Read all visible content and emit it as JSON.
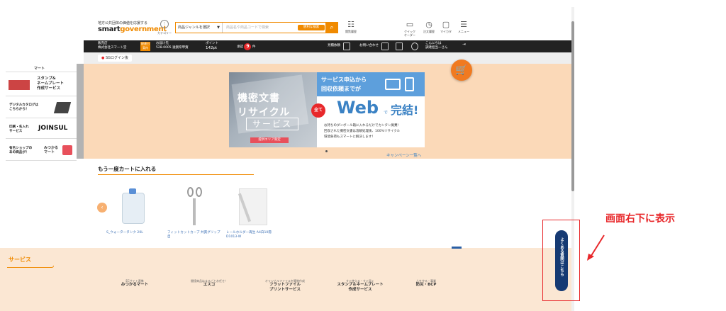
{
  "header": {
    "logo_sub": "地方公共団体の価値を応援する",
    "logo_main_a": "smart",
    "logo_main_b": "government",
    "category_label": "カテゴリー",
    "search_select": "商品ジャンルを選択",
    "search_placeholder": "商品名や商品コードで検索",
    "search_convenient": "便利な検索",
    "icons": [
      {
        "name": "purchase-history-icon",
        "label": "閲覧履歴"
      },
      {
        "name": "quick-order-icon",
        "label": "クイック\nオーダー"
      },
      {
        "name": "order-history-icon",
        "label": "注文履歴"
      },
      {
        "name": "my-folder-icon",
        "label": "マイカタ"
      },
      {
        "name": "menu-icon",
        "label": "メニュー"
      }
    ]
  },
  "blackbar": {
    "seller_label": "販売店",
    "seller_name": "株式会社スマート堂",
    "delivery_badge": "配達日\n案内",
    "delivery_label": "お届け先",
    "delivery_addr": "528-0005 滋賀県甲賀",
    "points_label": "ポイント",
    "points_value": "142pt",
    "approval_label": "承認",
    "approval_count": "9",
    "approval_unit": "件",
    "history_label": "見積依頼",
    "contact_label": "お問い合わせ",
    "greeting1": "こんにちは",
    "greeting2": "調達担当一さん"
  },
  "subbar": {
    "login_chip": "SGログイン後"
  },
  "sidebar": [
    {
      "title": "",
      "sub": "マート"
    },
    {
      "title": "",
      "sub": "スタンプ&\nネームプレート\n作成サービス"
    },
    {
      "title": "デジタルカタログは\nこちらから！",
      "sub": ""
    },
    {
      "title": "印刷・名入れ\nサービス",
      "sub": "JOINSUL"
    },
    {
      "title": "有名ショップの\nあの商品が！",
      "sub": "みつかる\nマート"
    }
  ],
  "banner": {
    "left_line1": "機密文書",
    "left_line2": "リサイクル",
    "left_line3": "サービス",
    "left_tag": "提供エリア限定",
    "right_head1": "サービス申込から",
    "right_head2": "回収依頼までが",
    "all_badge": "全て",
    "web": "Web",
    "de": "で",
    "kanketsu": "完結!",
    "desc1": "お持ちのダンボール箱に入れるだけでカンタン廃棄!",
    "desc2": "回収された機密文書は溶解処理後、100%リサイクル",
    "desc3": "環境負荷もスマートに解決します！"
  },
  "campaign_link": "キャンペーン一覧へ",
  "readd": {
    "title": "もう一度カートに入れる",
    "products": [
      {
        "name": "S_ウォータータンク 20L"
      },
      {
        "name": "フィットカットカーブ 共貫グリップ 自"
      },
      {
        "name": "レールホルダー再生 A4白10冊 D1013-W"
      }
    ]
  },
  "services": {
    "title": "サービス",
    "items": [
      {
        "sub": "ECサイト連携",
        "name": "みつかるマート"
      },
      {
        "sub": "間接商品はまるごとお任せ！",
        "name": "エスコ"
      },
      {
        "sub": "オリジナルファイルを簡単作成",
        "name": "フラットファイル\nプリントサービス"
      },
      {
        "sub": "すぐ使える・すぐ届く",
        "name": "スタンプ＆ネームプレート\n作成サービス"
      },
      {
        "sub": "人を守る・事業",
        "name": "防災・BCP"
      }
    ]
  },
  "faq_button": "よくある質問はこちら",
  "annotation": "画面右下に表示",
  "colors": {
    "accent": "#f08a00",
    "faq": "#163a73",
    "annotation": "#e8282b"
  }
}
